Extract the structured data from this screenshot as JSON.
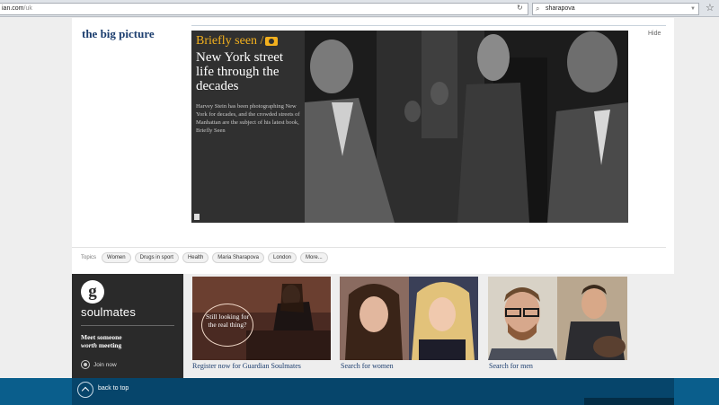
{
  "browser": {
    "url_main": "ian.com",
    "url_dim": "/uk",
    "search_value": "sharapova"
  },
  "section": {
    "title": "the big picture",
    "hide_label": "Hide"
  },
  "feature": {
    "kicker": "Briefly seen /",
    "headline": "New York street life through the decades",
    "standfirst": "Harvey Stein has been photographing New York for decades, and the crowded streets of Manhattan are the subject of his latest book, Briefly Seen"
  },
  "topics": {
    "label": "Topics",
    "tags": [
      "Women",
      "Drugs in sport",
      "Health",
      "Maria Sharapova",
      "London",
      "More..."
    ]
  },
  "soulmates": {
    "logo_letter": "g",
    "brand": "soulmates",
    "tagline_1": "Meet someone",
    "tagline_2_em": "worth",
    "tagline_2_rest": " meeting",
    "join_label": "Join now",
    "ad1_text": "Still looking for the real thing?",
    "caption_register": "Register now for Guardian Soulmates",
    "caption_women": "Search for women",
    "caption_men": "Search for men"
  },
  "footer": {
    "back_to_top": "back to top"
  },
  "colors": {
    "brand_navy": "#1b3d6e",
    "kicker_gold": "#f2b01e",
    "footer_blue": "#0a5e8c"
  }
}
